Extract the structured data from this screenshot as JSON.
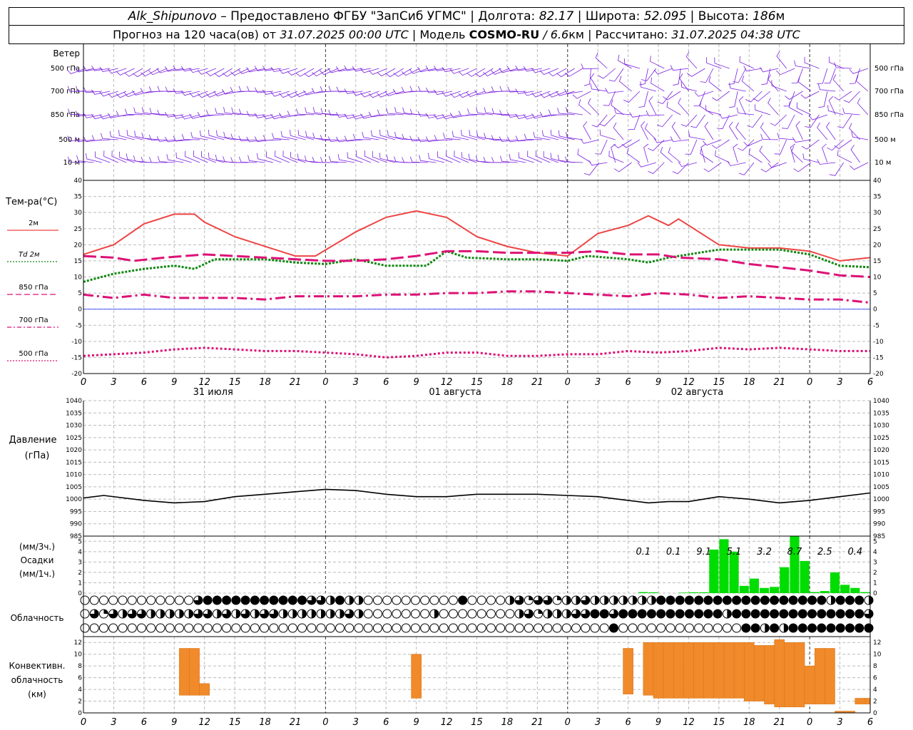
{
  "header": {
    "station": "Alk_Shipunovo",
    "provider": "– Предоставлено ФГБУ \"ЗапСиб УГМС\"",
    "lon_label": "| Долгота:",
    "lon_value": "82.17",
    "lat_label": "| Широта:",
    "lat_value": "52.095",
    "alt_label": "| Высота:",
    "alt_value": "186",
    "alt_unit": "м",
    "forecast_label": "Прогноз на 120 часа(ов) от",
    "forecast_time": "31.07.2025 00:00 UTC",
    "model_label": "| Модель",
    "model_name": "COSMO-RU",
    "model_res": "/ 6.6",
    "model_unit": "км",
    "computed_label": "| Рассчитано:",
    "computed_time": "31.07.2025 04:38 UTC"
  },
  "labels": {
    "wind": "Ветер",
    "wind_levels": [
      "500 гПа",
      "700 гПа",
      "850 гПа",
      "500 м",
      "10  м"
    ],
    "temp": "Тем-ра(°С)",
    "legend": [
      {
        "label": "2м",
        "color": "#ee4444",
        "style": "solid"
      },
      {
        "label": "Td  2м",
        "color": "#118811",
        "style": "dot"
      },
      {
        "label": "850 гПа",
        "color": "#dd1177",
        "style": "dash"
      },
      {
        "label": "700 гПа",
        "color": "#dd1177",
        "style": "dashdot"
      },
      {
        "label": "500 гПа",
        "color": "#dd1177",
        "style": "dotted"
      }
    ],
    "pressure_1": "Давление",
    "pressure_2": "(гПа)",
    "precip_1": "(мм/3ч.)",
    "precip_2": "Осадки",
    "precip_3": "(мм/1ч.)",
    "cloud": "Облачность",
    "conv_1": "Конвективн.",
    "conv_2": "облачность",
    "conv_3": "(км)"
  },
  "chart_data": {
    "type": "meteogram",
    "x_hours": [
      0,
      3,
      6,
      9,
      12,
      15,
      18,
      21,
      24,
      27,
      30,
      33,
      36,
      39,
      42,
      45,
      48,
      51,
      54,
      57,
      60,
      63,
      66,
      69,
      72,
      75,
      78
    ],
    "x_tick_labels": [
      "0",
      "3",
      "6",
      "9",
      "12",
      "15",
      "18",
      "21",
      "0",
      "3",
      "6",
      "9",
      "12",
      "15",
      "18",
      "21",
      "0",
      "3",
      "6",
      "9",
      "12",
      "15",
      "18",
      "21",
      "0",
      "3",
      "6"
    ],
    "date_labels": [
      {
        "hour": 12,
        "text": "31 июля"
      },
      {
        "hour": 36,
        "text": "01 августа"
      },
      {
        "hour": 60,
        "text": "02 августа"
      }
    ],
    "temperature": {
      "ylim": [
        -20,
        40
      ],
      "yticks": [
        40,
        35,
        30,
        25,
        20,
        15,
        10,
        5,
        0,
        -5,
        -10,
        -15,
        -20
      ],
      "series": [
        {
          "name": "2м",
          "color": "#ee4444",
          "style": "solid",
          "values": [
            [
              0,
              17
            ],
            [
              3,
              20
            ],
            [
              6,
              26.5
            ],
            [
              9,
              29.5
            ],
            [
              11,
              29.5
            ],
            [
              12,
              27
            ],
            [
              15,
              22.5
            ],
            [
              18,
              19.5
            ],
            [
              21,
              16.5
            ],
            [
              23,
              16.5
            ],
            [
              27,
              24
            ],
            [
              30,
              28.5
            ],
            [
              33,
              30.5
            ],
            [
              36,
              28.5
            ],
            [
              39,
              22.5
            ],
            [
              42,
              19.5
            ],
            [
              45,
              17.5
            ],
            [
              48,
              16.5
            ],
            [
              51,
              23.5
            ],
            [
              54,
              26
            ],
            [
              56,
              29
            ],
            [
              58,
              26
            ],
            [
              59,
              28
            ],
            [
              60,
              26
            ],
            [
              63,
              20
            ],
            [
              66,
              19
            ],
            [
              69,
              19
            ],
            [
              72,
              18
            ],
            [
              75,
              15
            ],
            [
              78,
              16
            ]
          ]
        },
        {
          "name": "Td  2м",
          "color": "#118811",
          "style": "dot",
          "values": [
            [
              0,
              8.5
            ],
            [
              3,
              11
            ],
            [
              6,
              12.5
            ],
            [
              9,
              13.5
            ],
            [
              11,
              12.5
            ],
            [
              13,
              15.5
            ],
            [
              18,
              15.5
            ],
            [
              21,
              14.5
            ],
            [
              24,
              14
            ],
            [
              27,
              15.5
            ],
            [
              30,
              13.5
            ],
            [
              34,
              13.5
            ],
            [
              36,
              18
            ],
            [
              38,
              16
            ],
            [
              42,
              15.5
            ],
            [
              45,
              15.5
            ],
            [
              48,
              15
            ],
            [
              50,
              16.5
            ],
            [
              54,
              15.5
            ],
            [
              56,
              14.5
            ],
            [
              58,
              16
            ],
            [
              63,
              18.5
            ],
            [
              69,
              18.5
            ],
            [
              72,
              17
            ],
            [
              75,
              13.5
            ],
            [
              78,
              13
            ]
          ]
        },
        {
          "name": "850 гПа",
          "color": "#dd1177",
          "style": "dash",
          "values": [
            [
              0,
              16.5
            ],
            [
              3,
              16
            ],
            [
              5,
              15
            ],
            [
              8,
              16
            ],
            [
              12,
              17
            ],
            [
              18,
              16
            ],
            [
              24,
              15
            ],
            [
              27,
              15
            ],
            [
              30,
              15.5
            ],
            [
              33,
              16.5
            ],
            [
              36,
              18
            ],
            [
              39,
              18
            ],
            [
              42,
              17.5
            ],
            [
              48,
              17.5
            ],
            [
              51,
              18
            ],
            [
              54,
              17
            ],
            [
              57,
              17
            ],
            [
              59,
              16
            ],
            [
              63,
              15.5
            ],
            [
              66,
              14
            ],
            [
              69,
              13
            ],
            [
              72,
              12
            ],
            [
              75,
              10.5
            ],
            [
              78,
              10
            ]
          ]
        },
        {
          "name": "700 гПа",
          "color": "#dd1177",
          "style": "dashdot",
          "values": [
            [
              0,
              4.5
            ],
            [
              3,
              3.5
            ],
            [
              6,
              4.5
            ],
            [
              9,
              3.5
            ],
            [
              12,
              3.5
            ],
            [
              15,
              3.5
            ],
            [
              18,
              3
            ],
            [
              21,
              4
            ],
            [
              24,
              4
            ],
            [
              27,
              4
            ],
            [
              30,
              4.5
            ],
            [
              33,
              4.5
            ],
            [
              36,
              5
            ],
            [
              39,
              5
            ],
            [
              42,
              5.5
            ],
            [
              45,
              5.5
            ],
            [
              48,
              5
            ],
            [
              51,
              4.5
            ],
            [
              54,
              4
            ],
            [
              57,
              5
            ],
            [
              60,
              4.5
            ],
            [
              63,
              3.5
            ],
            [
              66,
              4
            ],
            [
              69,
              3.5
            ],
            [
              72,
              3
            ],
            [
              75,
              3
            ],
            [
              78,
              2
            ]
          ]
        },
        {
          "name": "500 гПа",
          "color": "#dd1177",
          "style": "dotted",
          "values": [
            [
              0,
              -14.5
            ],
            [
              3,
              -14
            ],
            [
              6,
              -13.5
            ],
            [
              9,
              -12.5
            ],
            [
              12,
              -12
            ],
            [
              15,
              -12.5
            ],
            [
              18,
              -13
            ],
            [
              21,
              -13
            ],
            [
              24,
              -13.5
            ],
            [
              27,
              -14
            ],
            [
              30,
              -15
            ],
            [
              33,
              -14.5
            ],
            [
              36,
              -13.5
            ],
            [
              39,
              -13.5
            ],
            [
              42,
              -14.5
            ],
            [
              45,
              -14.5
            ],
            [
              48,
              -14
            ],
            [
              51,
              -14
            ],
            [
              54,
              -13
            ],
            [
              57,
              -13.5
            ],
            [
              60,
              -13
            ],
            [
              63,
              -12
            ],
            [
              66,
              -12.5
            ],
            [
              69,
              -12
            ],
            [
              72,
              -12.5
            ],
            [
              75,
              -13
            ],
            [
              78,
              -13
            ]
          ]
        }
      ]
    },
    "pressure": {
      "ylim": [
        985,
        1040
      ],
      "yticks": [
        1040,
        1035,
        1030,
        1025,
        1020,
        1015,
        1010,
        1005,
        1000,
        995,
        990,
        985
      ],
      "values": [
        [
          0,
          1000.5
        ],
        [
          2,
          1001.5
        ],
        [
          6,
          999.5
        ],
        [
          9,
          998.5
        ],
        [
          12,
          999
        ],
        [
          15,
          1001
        ],
        [
          18,
          1002
        ],
        [
          21,
          1003
        ],
        [
          24,
          1004
        ],
        [
          27,
          1003.5
        ],
        [
          30,
          1002
        ],
        [
          33,
          1001
        ],
        [
          36,
          1001
        ],
        [
          39,
          1002
        ],
        [
          42,
          1002
        ],
        [
          45,
          1002
        ],
        [
          48,
          1001.5
        ],
        [
          51,
          1001
        ],
        [
          54,
          999.5
        ],
        [
          56,
          998.5
        ],
        [
          58,
          999
        ],
        [
          60,
          999
        ],
        [
          63,
          1001
        ],
        [
          66,
          1000
        ],
        [
          69,
          998.5
        ],
        [
          72,
          999.5
        ],
        [
          75,
          1001
        ],
        [
          78,
          1002.5
        ]
      ]
    },
    "precipitation": {
      "ylim": [
        0,
        5.5
      ],
      "yticks": [
        5,
        4,
        3,
        2,
        1,
        0
      ],
      "bars": [
        [
          55.5,
          0.1
        ],
        [
          56.5,
          0.08
        ],
        [
          59.5,
          0.05
        ],
        [
          60.5,
          0.08
        ],
        [
          61.5,
          0.08
        ],
        [
          62.5,
          4.2
        ],
        [
          63.5,
          5.2
        ],
        [
          64.5,
          4
        ],
        [
          65.5,
          0.7
        ],
        [
          66.5,
          1.4
        ],
        [
          67.5,
          0.5
        ],
        [
          68.5,
          0.6
        ],
        [
          69.5,
          2.5
        ],
        [
          70.5,
          5.9
        ],
        [
          71.5,
          3.1
        ],
        [
          72.5,
          0.1
        ],
        [
          73.5,
          0.2
        ],
        [
          74.5,
          2
        ],
        [
          75.5,
          0.8
        ],
        [
          76.5,
          0.5
        ],
        [
          77.5,
          0.1
        ]
      ],
      "totals": [
        {
          "hour": 55.5,
          "text": "0.1"
        },
        {
          "hour": 58.5,
          "text": "0.1"
        },
        {
          "hour": 61.5,
          "text": "9.1"
        },
        {
          "hour": 64.5,
          "text": "5.1"
        },
        {
          "hour": 67.5,
          "text": "3.2"
        },
        {
          "hour": 70.5,
          "text": "8.7"
        },
        {
          "hour": 73.5,
          "text": "2.5"
        },
        {
          "hour": 76.5,
          "text": "0.4"
        }
      ]
    },
    "cloudiness": {
      "rows": [
        "000000000000344444444444332422000000000040000231331223222222244444444444444444424442",
        "031323322222332323233222222232000000020000000023122233443444444444442444444444444443",
        "000000000000000000000000000000000000000000000000000000004000000000000044242444444444"
      ]
    },
    "convective": {
      "ylim": [
        0,
        13
      ],
      "yticks": [
        12,
        10,
        8,
        6,
        4,
        2,
        0
      ],
      "bars": [
        [
          9.5,
          10.5,
          3,
          11
        ],
        [
          10.5,
          11.5,
          3,
          11
        ],
        [
          11.5,
          12.5,
          3,
          5
        ],
        [
          32.5,
          33.5,
          2.5,
          10
        ],
        [
          53.5,
          54.5,
          3.2,
          11
        ],
        [
          55.5,
          56.5,
          3,
          12
        ],
        [
          56.5,
          57.5,
          2.5,
          12
        ],
        [
          57.5,
          58.5,
          2.5,
          12
        ],
        [
          58.5,
          59.5,
          2.5,
          12
        ],
        [
          59.5,
          60.5,
          2.5,
          12
        ],
        [
          60.5,
          61.5,
          2.5,
          12
        ],
        [
          61.5,
          62.5,
          2.5,
          12
        ],
        [
          62.5,
          63.5,
          2.5,
          12
        ],
        [
          63.5,
          64.5,
          2.5,
          12
        ],
        [
          64.5,
          65.5,
          2.5,
          12
        ],
        [
          65.5,
          66.5,
          2,
          12
        ],
        [
          66.5,
          67.5,
          2,
          11.5
        ],
        [
          67.5,
          68.5,
          1.5,
          11.5
        ],
        [
          68.5,
          69.5,
          1,
          12.5
        ],
        [
          69.5,
          70.5,
          1,
          12
        ],
        [
          70.5,
          71.5,
          1,
          12
        ],
        [
          71.5,
          72.5,
          1.5,
          8
        ],
        [
          72.5,
          73.5,
          1.5,
          11
        ],
        [
          73.5,
          74.5,
          1.5,
          11
        ],
        [
          74.5,
          75.5,
          0,
          0.3
        ],
        [
          75.5,
          76.5,
          0,
          0.3
        ],
        [
          76.5,
          77.5,
          1.5,
          2.5
        ],
        [
          77.5,
          78,
          1.5,
          2.5
        ]
      ]
    },
    "wind": {
      "levels": [
        "500 гПа",
        "700 гПа",
        "850 гПа",
        "500 м",
        "10  м"
      ],
      "barbs_per_row": 97
    }
  }
}
